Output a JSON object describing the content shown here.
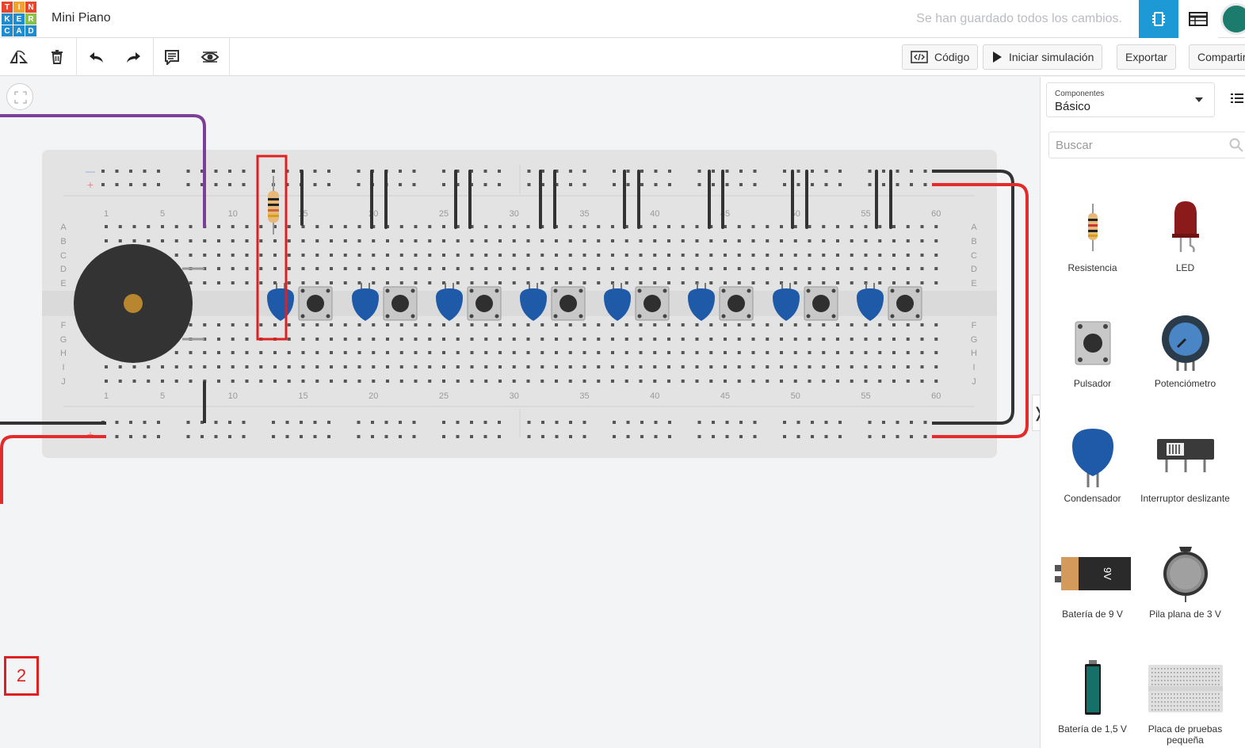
{
  "header": {
    "logo_letters": [
      "T",
      "I",
      "N",
      "K",
      "E",
      "R",
      "C",
      "A",
      "D"
    ],
    "logo_colors": [
      "#e8452c",
      "#f2a12c",
      "#e8452c",
      "#1f8ccf",
      "#1f8ccf",
      "#8ac249",
      "#1f8ccf",
      "#1f8ccf",
      "#1f8ccf"
    ],
    "project_title": "Mini Piano",
    "save_status": "Se han guardado todos los cambios."
  },
  "toolbar": {
    "code_label": "Código",
    "simulate_label": "Iniciar simulación",
    "export_label": "Exportar",
    "share_label": "Compartir"
  },
  "canvas": {
    "marker_label": "2",
    "row_letters_top": [
      "A",
      "B",
      "C",
      "D",
      "E"
    ],
    "row_letters_bottom": [
      "F",
      "G",
      "H",
      "I",
      "J"
    ],
    "column_numbers": [
      "1",
      "5",
      "10",
      "15",
      "20",
      "25",
      "30",
      "35",
      "40",
      "45",
      "50",
      "55",
      "60"
    ],
    "colors": {
      "breadboard": "#e3e3e3",
      "wire_red": "#e32b2b",
      "wire_black": "#333333",
      "wire_purple": "#7b3f9a",
      "capacitor": "#1e5aa8",
      "highlight": "#e02020"
    }
  },
  "panel": {
    "select_label": "Componentes",
    "select_value": "Básico",
    "search_placeholder": "Buscar",
    "components": [
      {
        "name": "Resistencia",
        "icon": "resistor-icon"
      },
      {
        "name": "LED",
        "icon": "led-icon"
      },
      {
        "name": "Pulsador",
        "icon": "pushbutton-icon"
      },
      {
        "name": "Potenciómetro",
        "icon": "potentiometer-icon"
      },
      {
        "name": "Condensador",
        "icon": "capacitor-icon"
      },
      {
        "name": "Interruptor deslizante",
        "icon": "slide-switch-icon"
      },
      {
        "name": "Batería de 9 V",
        "icon": "battery-9v-icon",
        "label": "9V"
      },
      {
        "name": "Pila plana de 3 V",
        "icon": "coin-battery-icon"
      },
      {
        "name": "Batería de 1,5 V",
        "icon": "battery-aa-icon"
      },
      {
        "name": "Placa de pruebas pequeña",
        "icon": "breadboard-small-icon"
      }
    ]
  }
}
